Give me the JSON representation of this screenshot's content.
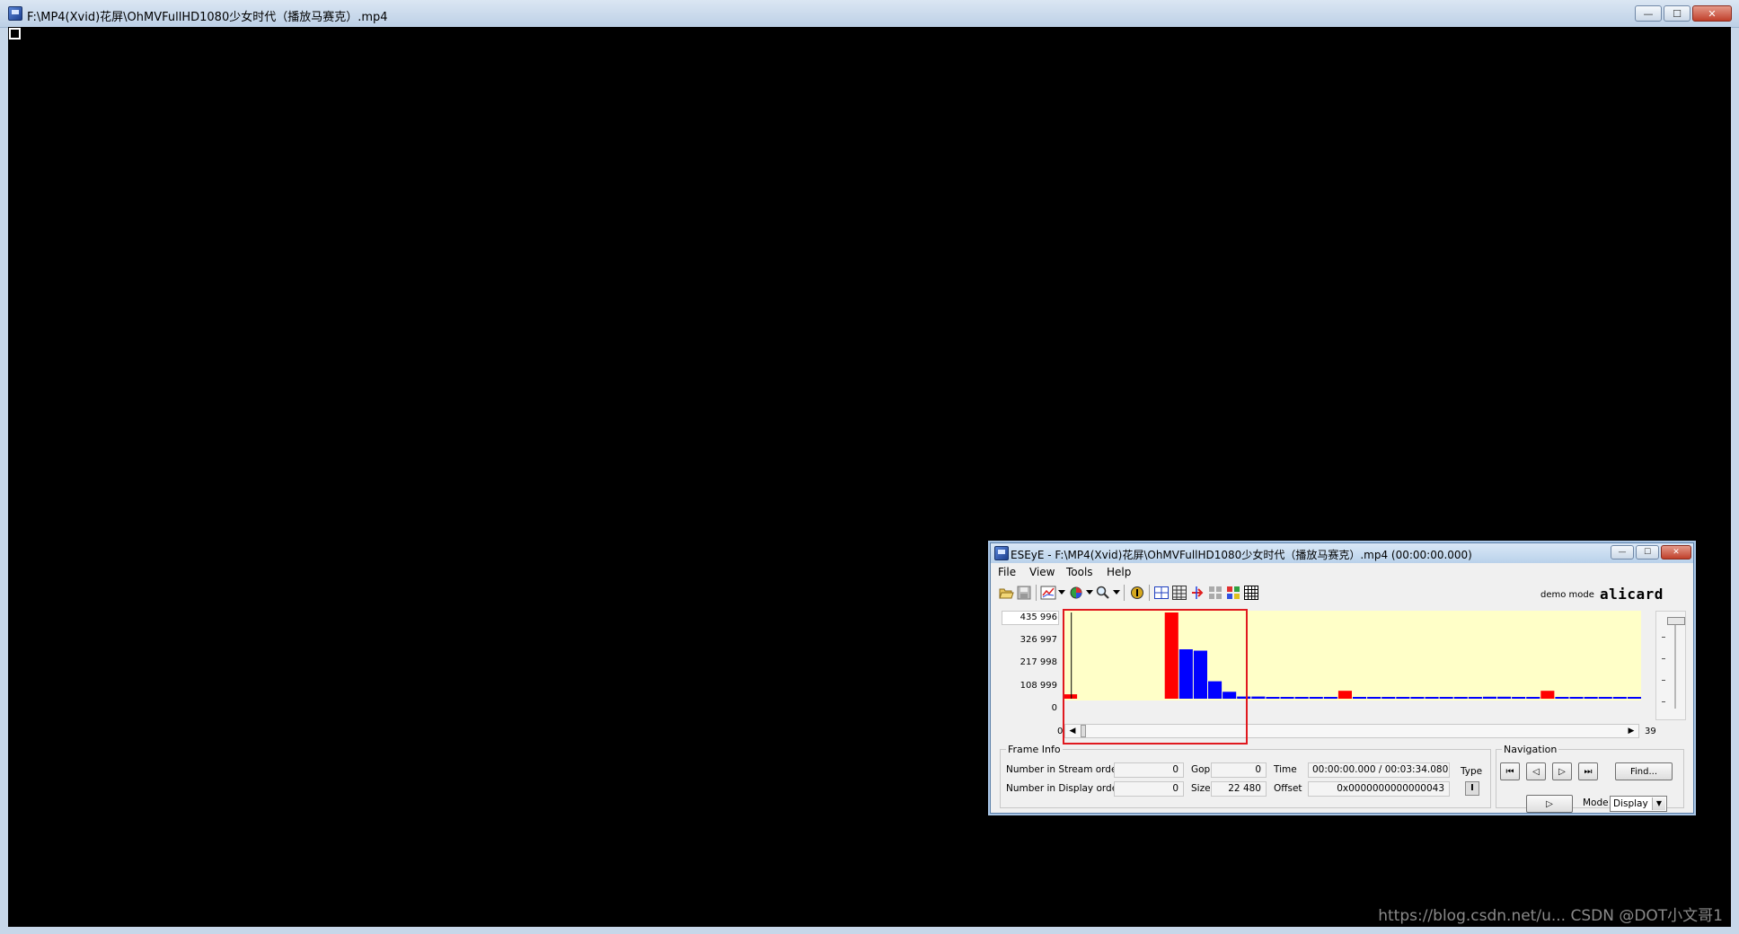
{
  "player": {
    "title": "F:\\MP4(Xvid)花屏\\OhMVFullHD1080少女时代（播放马赛克）.mp4",
    "window_buttons": {
      "minimize": "—",
      "maximize": "☐",
      "close": "✕"
    }
  },
  "eseye": {
    "title": "ESEyE - F:\\MP4(Xvid)花屏\\OhMVFullHD1080少女时代（播放马赛克）.mp4 (00:00:00.000)",
    "window_buttons": {
      "minimize": "—",
      "maximize": "☐",
      "close": "✕"
    },
    "menu": [
      "File",
      "View",
      "Tools",
      "Help"
    ],
    "toolbar": {
      "icons": [
        "open-icon",
        "save-icon",
        "chart-type-icon",
        "color-icon",
        "zoom-icon",
        "info-icon",
        "grid-icon",
        "table-icon",
        "export-icon",
        "tile-icon",
        "palette-icon",
        "matrix-icon"
      ],
      "demo_mode": "demo mode",
      "logo": "alicard"
    },
    "chart_data": {
      "type": "bar",
      "y_tick_labels": [
        "435 996",
        "326 997",
        "217 998",
        "108 999",
        "0"
      ],
      "ylim": [
        0,
        435996
      ],
      "x_start_label": "0",
      "x_end_label": "39",
      "cursor_index": 0,
      "colors": {
        "I": "#ff0000",
        "P": "#0000ff",
        "background": "#ffffc8"
      },
      "frames": [
        {
          "index": 0,
          "type": "I",
          "value": 22480
        },
        {
          "index": 7,
          "type": "I",
          "value": 435996
        },
        {
          "index": 8,
          "type": "P",
          "value": 250000
        },
        {
          "index": 9,
          "type": "P",
          "value": 243000
        },
        {
          "index": 10,
          "type": "P",
          "value": 88000
        },
        {
          "index": 11,
          "type": "P",
          "value": 35000
        },
        {
          "index": 12,
          "type": "P",
          "value": 11000
        },
        {
          "index": 13,
          "type": "P",
          "value": 11000
        },
        {
          "index": 14,
          "type": "P",
          "value": 9000
        },
        {
          "index": 15,
          "type": "P",
          "value": 9000
        },
        {
          "index": 16,
          "type": "P",
          "value": 9000
        },
        {
          "index": 17,
          "type": "P",
          "value": 4000
        },
        {
          "index": 18,
          "type": "P",
          "value": 6000
        },
        {
          "index": 19,
          "type": "I",
          "value": 40000
        },
        {
          "index": 20,
          "type": "P",
          "value": 6000
        },
        {
          "index": 21,
          "type": "P",
          "value": 6000
        },
        {
          "index": 22,
          "type": "P",
          "value": 2000
        },
        {
          "index": 23,
          "type": "P",
          "value": 2000
        },
        {
          "index": 24,
          "type": "P",
          "value": 6000
        },
        {
          "index": 25,
          "type": "P",
          "value": 6000
        },
        {
          "index": 26,
          "type": "P",
          "value": 6000
        },
        {
          "index": 27,
          "type": "P",
          "value": 6000
        },
        {
          "index": 28,
          "type": "P",
          "value": 2000
        },
        {
          "index": 29,
          "type": "P",
          "value": 10000
        },
        {
          "index": 30,
          "type": "P",
          "value": 10000
        },
        {
          "index": 31,
          "type": "P",
          "value": 8000
        },
        {
          "index": 32,
          "type": "P",
          "value": 8000
        },
        {
          "index": 33,
          "type": "I",
          "value": 40000
        },
        {
          "index": 34,
          "type": "P",
          "value": 6000
        },
        {
          "index": 35,
          "type": "P",
          "value": 6000
        },
        {
          "index": 36,
          "type": "P",
          "value": 4000
        },
        {
          "index": 37,
          "type": "P",
          "value": 4000
        },
        {
          "index": 38,
          "type": "P",
          "value": 6000
        },
        {
          "index": 39,
          "type": "P",
          "value": 6000
        }
      ],
      "visible_start": 0,
      "visible_count": 40
    },
    "frame_info": {
      "legend": "Frame Info",
      "stream_order_label": "Number in Stream order",
      "stream_order_value": "0",
      "display_order_label": "Number in Display order",
      "display_order_value": "0",
      "gop_label": "Gop",
      "gop_value": "0",
      "size_label": "Size",
      "size_value": "22 480",
      "time_label": "Time",
      "time_value": "00:00:00.000 / 00:03:34.080",
      "offset_label": "Offset",
      "offset_value": "0x0000000000000043",
      "type_label": "Type",
      "type_value": "I"
    },
    "navigation": {
      "legend": "Navigation",
      "first": "⏮",
      "prev": "◁",
      "next": "▷",
      "last": "⏭",
      "find": "Find...",
      "play": "▷",
      "mode_label": "Mode",
      "mode_value": "Display"
    }
  },
  "watermark": "https://blog.csdn.net/u... CSDN @DOT小文哥1"
}
